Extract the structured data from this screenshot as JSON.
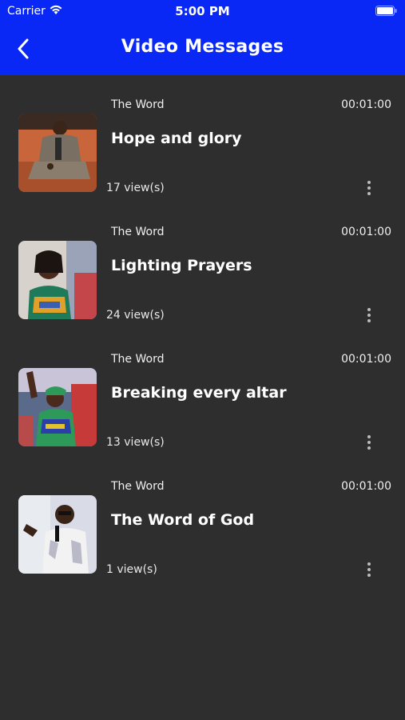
{
  "status_bar": {
    "carrier": "Carrier",
    "time": "5:00 PM"
  },
  "header": {
    "title": "Video Messages",
    "background": "#0a28f5"
  },
  "videos": [
    {
      "category": "The Word",
      "duration": "00:01:00",
      "title": "Hope and glory",
      "views": "17 view(s)",
      "thumbnail": "man-seated-thumbnail"
    },
    {
      "category": "The Word",
      "duration": "00:01:00",
      "title": "Lighting Prayers",
      "views": "24 view(s)",
      "thumbnail": "woman-smiling-thumbnail"
    },
    {
      "category": "The Word",
      "duration": "00:01:00",
      "title": "Breaking every altar",
      "views": "13 view(s)",
      "thumbnail": "woman-worship-thumbnail"
    },
    {
      "category": "The Word",
      "duration": "00:01:00",
      "title": "The Word of God",
      "views": "1 view(s)",
      "thumbnail": "preacher-thumbnail"
    }
  ]
}
